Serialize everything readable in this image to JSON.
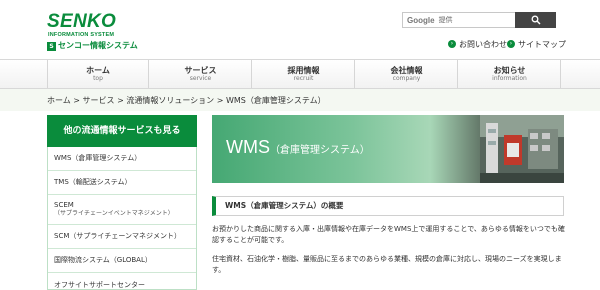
{
  "header": {
    "logo_main": "SENKO",
    "logo_sub": "INFORMATION SYSTEM",
    "logo_jp_mark": "S",
    "logo_jp": "センコー情報システム",
    "search": {
      "provider": "Google",
      "placeholder": "提供"
    },
    "links": [
      {
        "label": "お問い合わせ",
        "icon": "arrow-right-icon"
      },
      {
        "label": "サイトマップ",
        "icon": "arrow-right-icon"
      }
    ]
  },
  "nav": [
    {
      "label": "ホーム",
      "en": "top"
    },
    {
      "label": "サービス",
      "en": "service"
    },
    {
      "label": "採用情報",
      "en": "recruit"
    },
    {
      "label": "会社情報",
      "en": "company"
    },
    {
      "label": "お知らせ",
      "en": "information"
    }
  ],
  "breadcrumb": "ホーム > サービス > 流通情報ソリューション > WMS（倉庫管理システム）",
  "sidebar": {
    "heading": "他の流通情報サービスも見る",
    "items": [
      {
        "label": "WMS（倉庫管理システム）",
        "sub": ""
      },
      {
        "label": "TMS（輸配送システム）",
        "sub": ""
      },
      {
        "label": "SCEM",
        "sub": "（サプライチェーンイベントマネジメント）"
      },
      {
        "label": "SCM（サプライチェーンマネジメント）",
        "sub": ""
      },
      {
        "label": "国際物流システム（GLOBAL）",
        "sub": ""
      },
      {
        "label": "オフサイトサポートセンター",
        "sub": ""
      }
    ]
  },
  "hero": {
    "title": "WMS",
    "subtitle": "（倉庫管理システム）"
  },
  "section": {
    "heading": "WMS（倉庫管理システム）の概要",
    "paragraphs": [
      "お預かりした商品に関する入庫・出庫情報や在庫データをWMS上で運用することで、あらゆる情報をいつでも確認することが可能です。",
      "住宅資材、石油化学・樹脂、量販品に至るまでのあらゆる業種、規模の倉庫に対応し、現場のニーズを実現します。"
    ]
  },
  "colors": {
    "brand": "#0a8c3c",
    "nav_bg": "#f2f2f2",
    "band_bg": "#f4f8f2"
  }
}
